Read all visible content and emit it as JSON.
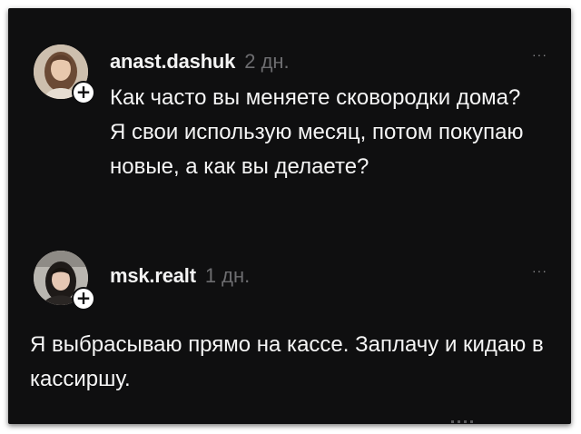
{
  "comments": [
    {
      "username": "anast.dashuk",
      "time": "2 дн.",
      "text": "Как часто вы меняете сковородки дома? Я свои использую месяц, потом покупаю новые, а как вы делаете?",
      "follow_icon": "+",
      "more_icon": "···"
    },
    {
      "username": "msk.realt",
      "time": "1 дн.",
      "text": "Я выбрасываю прямо на кассе. Заплачу и кидаю в кассиршу.",
      "follow_icon": "+",
      "more_icon": "···"
    }
  ],
  "colors": {
    "background": "#0f0f10",
    "text": "#f5f5f5",
    "muted": "#6d6d70"
  }
}
